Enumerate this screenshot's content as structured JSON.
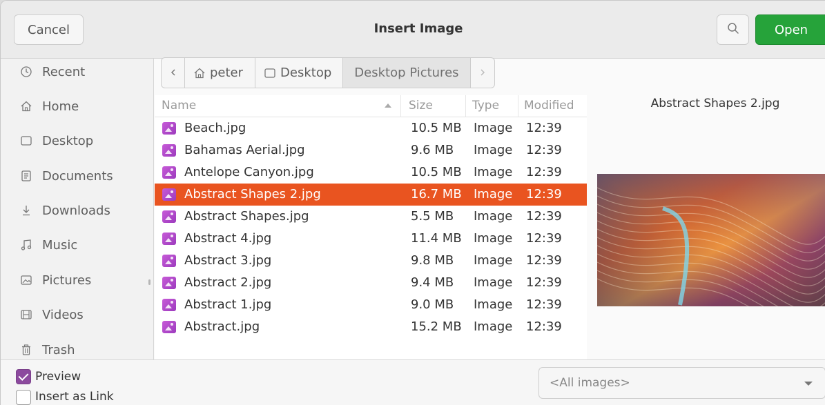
{
  "header": {
    "title": "Insert Image",
    "cancel_label": "Cancel",
    "open_label": "Open",
    "accent_open": "#26a33a"
  },
  "sidebar": {
    "items": [
      {
        "label": "Recent",
        "icon": "clock-icon"
      },
      {
        "label": "Home",
        "icon": "home-icon"
      },
      {
        "label": "Desktop",
        "icon": "desktop-icon"
      },
      {
        "label": "Documents",
        "icon": "document-icon"
      },
      {
        "label": "Downloads",
        "icon": "download-icon"
      },
      {
        "label": "Music",
        "icon": "music-icon"
      },
      {
        "label": "Pictures",
        "icon": "picture-icon"
      },
      {
        "label": "Videos",
        "icon": "video-icon"
      },
      {
        "label": "Trash",
        "icon": "trash-icon"
      }
    ]
  },
  "pathbar": {
    "segments": [
      "peter",
      "Desktop",
      "Desktop Pictures"
    ]
  },
  "filelist": {
    "columns": {
      "name": "Name",
      "size": "Size",
      "type": "Type",
      "modified": "Modified"
    },
    "rows": [
      {
        "name": "Beach.jpg",
        "size": "10.5 MB",
        "type": "Image",
        "modified": "12:39"
      },
      {
        "name": "Bahamas Aerial.jpg",
        "size": "9.6 MB",
        "type": "Image",
        "modified": "12:39"
      },
      {
        "name": "Antelope Canyon.jpg",
        "size": "10.5 MB",
        "type": "Image",
        "modified": "12:39"
      },
      {
        "name": "Abstract Shapes 2.jpg",
        "size": "16.7 MB",
        "type": "Image",
        "modified": "12:39"
      },
      {
        "name": "Abstract Shapes.jpg",
        "size": "5.5 MB",
        "type": "Image",
        "modified": "12:39"
      },
      {
        "name": "Abstract 4.jpg",
        "size": "11.4 MB",
        "type": "Image",
        "modified": "12:39"
      },
      {
        "name": "Abstract 3.jpg",
        "size": "9.8 MB",
        "type": "Image",
        "modified": "12:39"
      },
      {
        "name": "Abstract 2.jpg",
        "size": "9.4 MB",
        "type": "Image",
        "modified": "12:39"
      },
      {
        "name": "Abstract 1.jpg",
        "size": "9.0 MB",
        "type": "Image",
        "modified": "12:39"
      },
      {
        "name": "Abstract.jpg",
        "size": "15.2 MB",
        "type": "Image",
        "modified": "12:39"
      }
    ],
    "selected_index": 3,
    "selection_color": "#e95420"
  },
  "preview": {
    "filename": "Abstract Shapes 2.jpg"
  },
  "options": {
    "preview_label": "Preview",
    "preview_checked": true,
    "insert_link_label": "Insert as Link",
    "insert_link_checked": false
  },
  "filter": {
    "selected": "<All images>"
  }
}
